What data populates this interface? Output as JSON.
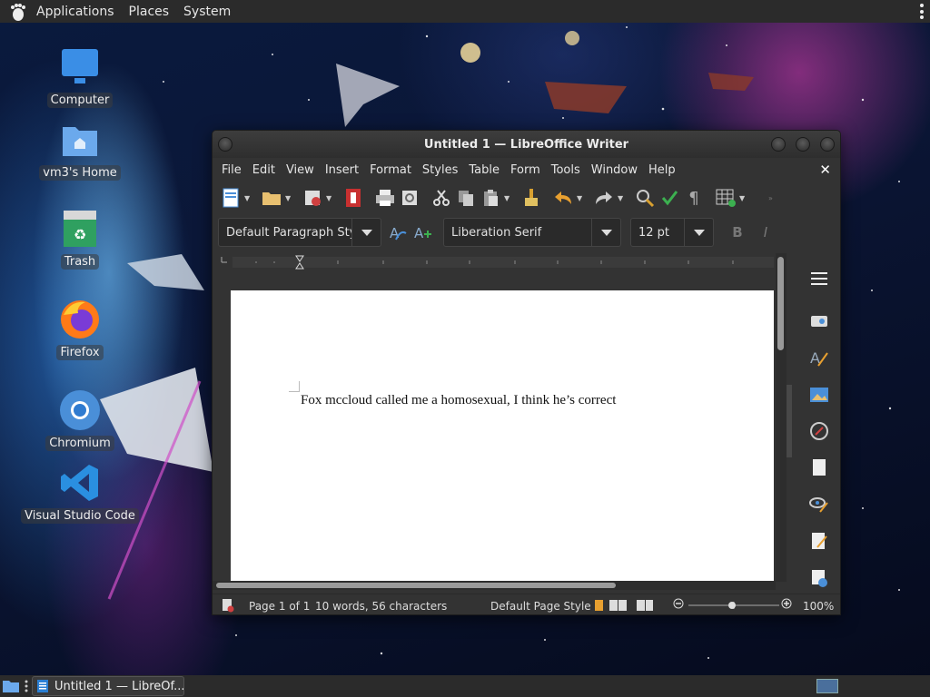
{
  "top_panel": {
    "applications": "Applications",
    "places": "Places",
    "system": "System"
  },
  "desktop": {
    "icons": [
      {
        "label": "Computer",
        "icon": "computer-icon"
      },
      {
        "label": "vm3's Home",
        "icon": "home-folder-icon"
      },
      {
        "label": "Trash",
        "icon": "trash-icon"
      },
      {
        "label": "Firefox",
        "icon": "firefox-icon"
      },
      {
        "label": "Chromium",
        "icon": "chromium-icon"
      },
      {
        "label": "Visual Studio Code",
        "icon": "vscode-icon"
      }
    ]
  },
  "window": {
    "title": "Untitled 1 — LibreOffice Writer",
    "menu": [
      "File",
      "Edit",
      "View",
      "Insert",
      "Format",
      "Styles",
      "Table",
      "Form",
      "Tools",
      "Window",
      "Help"
    ],
    "paragraph_style": "Default Paragraph Sty",
    "font_name": "Liberation Serif",
    "font_size": "12 pt",
    "bold_label": "B",
    "italic_label": "I",
    "document_text": "Fox mccloud called me a homosexual, I think he’s correct",
    "status": {
      "page": "Page 1 of 1",
      "words": "10 words, 56 characters",
      "page_style": "Default Page Style",
      "zoom": "100%"
    }
  },
  "taskbar": {
    "task_label": "Untitled 1 — LibreOf..."
  },
  "colors": {
    "panel_bg": "#2b2b2b",
    "window_bg": "#333333",
    "accent_blue": "#4a8fd8",
    "orange": "#e8a030"
  }
}
